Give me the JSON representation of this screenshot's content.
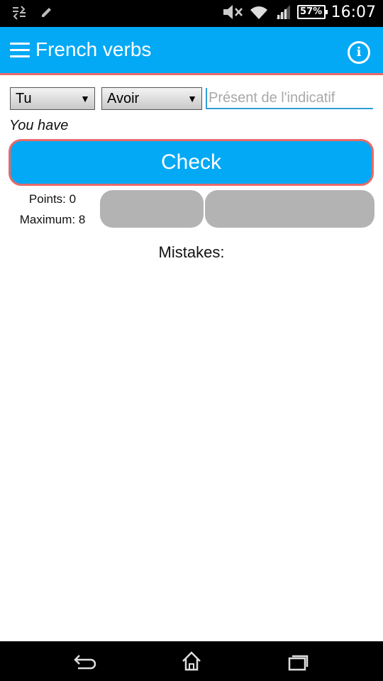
{
  "status_bar": {
    "time": "16:07",
    "battery": "57%",
    "icons": [
      "data-transfer-icon",
      "edit-icon",
      "mute-icon",
      "wifi-icon",
      "signal-icon",
      "battery-icon"
    ]
  },
  "app_bar": {
    "title": "French verbs",
    "menu_icon": "menu-icon",
    "info_icon": "info-icon",
    "info_glyph": "i"
  },
  "form": {
    "person_value": "Tu",
    "verb_value": "Avoir",
    "tense_placeholder": "Présent de l'indicatif",
    "tense_value": ""
  },
  "translation": "You have",
  "check_label": "Check",
  "score": {
    "points_text": "Points: 0",
    "maximum_text": "Maximum: 8"
  },
  "mistakes_label": "Mistakes:",
  "colors": {
    "accent": "#03a9f4",
    "highlight_border": "#e96a6a",
    "score_bar": "#b3b3b3"
  },
  "nav_bar": {
    "icons": [
      "back-icon",
      "home-icon",
      "recent-apps-icon"
    ]
  }
}
